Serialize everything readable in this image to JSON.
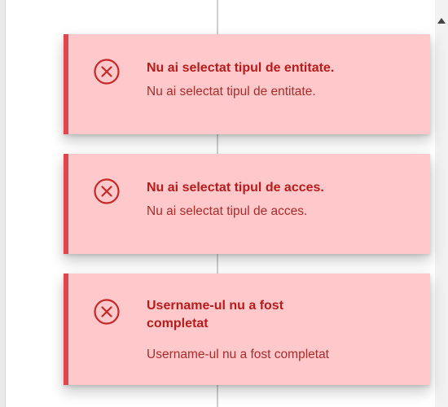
{
  "notifications": [
    {
      "title": "Nu ai selectat tipul de entitate.",
      "message": "Nu ai selectat tipul de entitate.",
      "type": "error",
      "icon": "error-x-circle-icon"
    },
    {
      "title": "Nu ai selectat tipul de acces.",
      "message": "Nu ai selectat tipul de acces.",
      "type": "error",
      "icon": "error-x-circle-icon"
    },
    {
      "title": "Username-ul nu a fost completat",
      "message": "Username-ul nu a fost completat",
      "type": "error",
      "icon": "error-x-circle-icon"
    }
  ],
  "colors": {
    "toast_background": "#ffc9cb",
    "toast_border": "#e0474d",
    "title_text": "#b71c1c",
    "message_text": "#a92b2b",
    "icon": "#c62828"
  }
}
